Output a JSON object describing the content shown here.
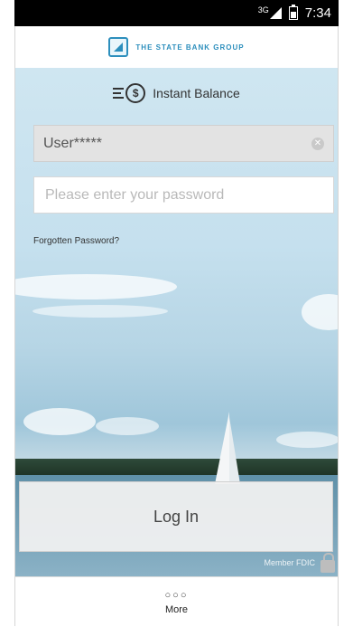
{
  "status_bar": {
    "network": "3G",
    "time": "7:34"
  },
  "brand": {
    "name": "THE STATE BANK GROUP"
  },
  "balance": {
    "label": "Instant Balance",
    "icon_symbol": "$"
  },
  "login_form": {
    "username_value": "User*****",
    "password_placeholder": "Please enter your password",
    "forgot_label": "Forgotten Password?",
    "login_label": "Log In"
  },
  "footer": {
    "fdic_label": "Member FDIC"
  },
  "bottom_nav": {
    "more_icon": "○○○",
    "more_label": "More"
  },
  "colors": {
    "brand": "#2d8fbd",
    "status_bar": "#000000",
    "field_bg": "#e3e3e3"
  }
}
